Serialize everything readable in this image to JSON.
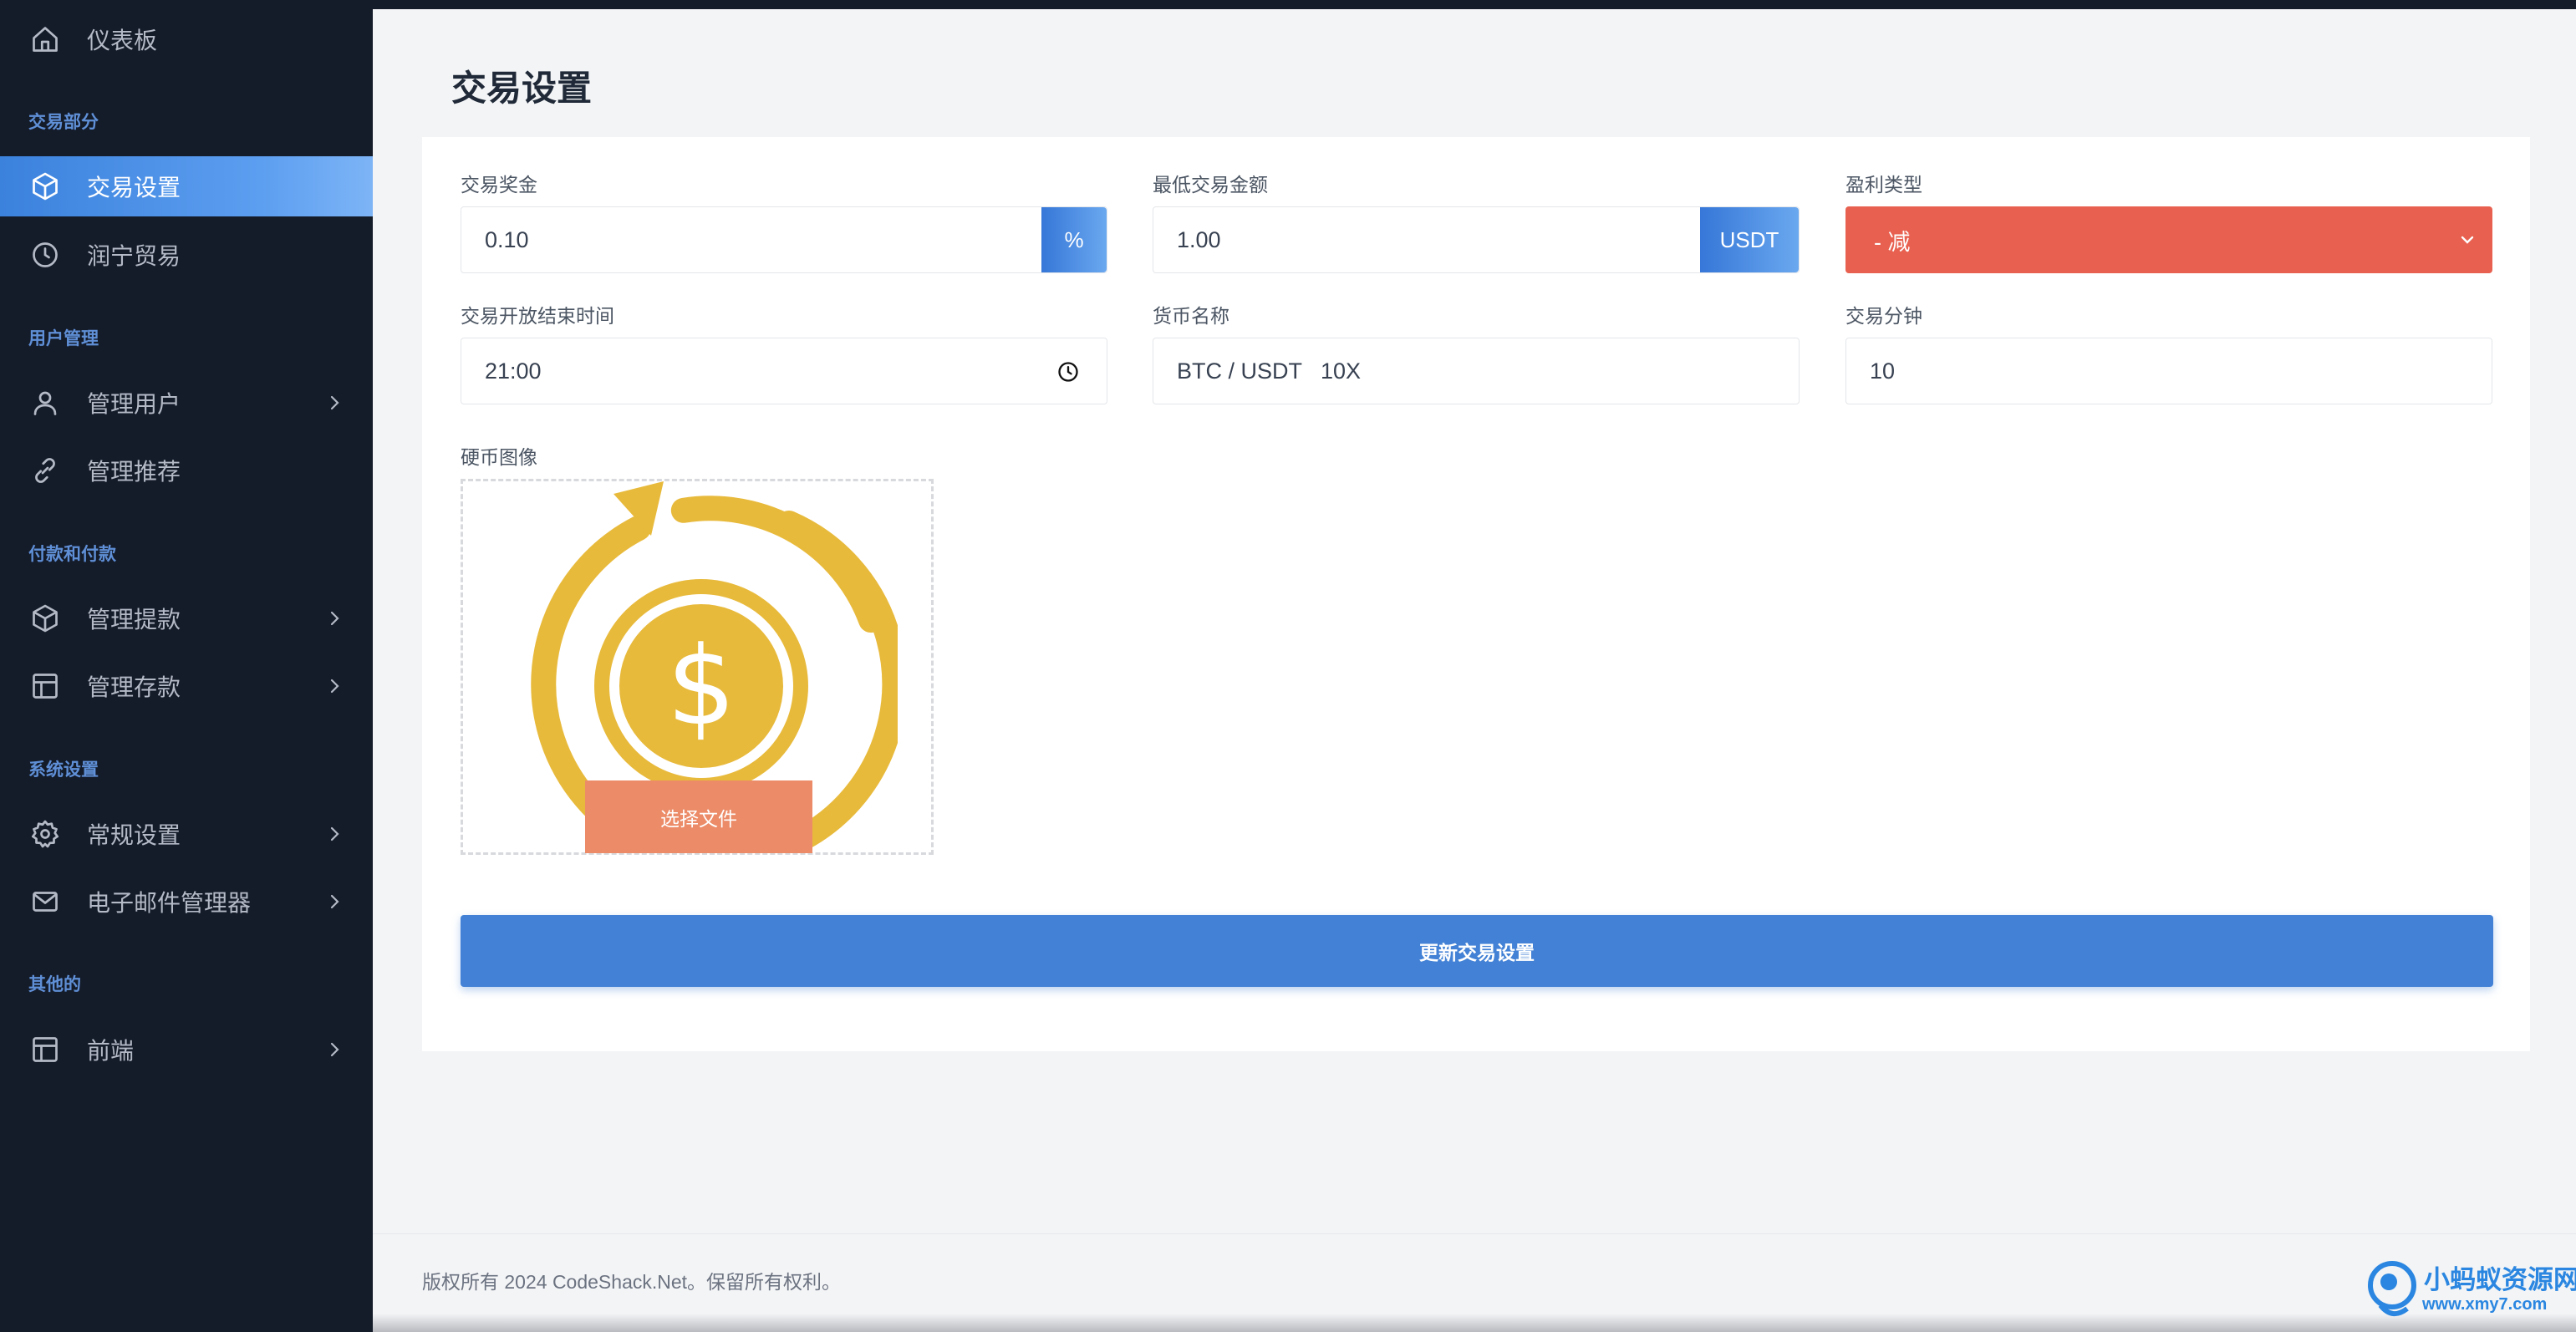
{
  "sidebar": {
    "items": [
      {
        "label": "仪表板",
        "icon": "home-icon"
      },
      {
        "label": "交易设置",
        "icon": "cube-icon",
        "active": true
      },
      {
        "label": "润宁贸易",
        "icon": "clock-icon"
      },
      {
        "label": "管理用户",
        "icon": "user-icon"
      },
      {
        "label": "管理推荐",
        "icon": "link-icon"
      },
      {
        "label": "管理提款",
        "icon": "cube-icon"
      },
      {
        "label": "管理存款",
        "icon": "table-icon"
      },
      {
        "label": "常规设置",
        "icon": "gear-icon"
      },
      {
        "label": "电子邮件管理器",
        "icon": "mail-icon"
      },
      {
        "label": "前端",
        "icon": "layout-icon"
      }
    ],
    "sections": [
      "交易部分",
      "用户管理",
      "付款和付款",
      "系统设置",
      "其他的"
    ]
  },
  "page": {
    "title": "交易设置"
  },
  "form": {
    "bonus": {
      "label": "交易奖金",
      "value": "0.10",
      "addon": "%"
    },
    "min_amount": {
      "label": "最低交易金额",
      "value": "1.00",
      "addon": "USDT"
    },
    "profit_type": {
      "label": "盈利类型",
      "value": "- 减"
    },
    "open_time": {
      "label": "交易开放结束时间",
      "value": "21:00"
    },
    "coin_name": {
      "label": "货币名称",
      "value": "BTC / USDT   10X"
    },
    "trade_minutes": {
      "label": "交易分钟",
      "value": "10"
    },
    "coin_image": {
      "label": "硬币图像",
      "button": "选择文件"
    },
    "submit": "更新交易设置"
  },
  "footer": {
    "copyright": "版权所有 2024 CodeShack.Net。保留所有权利。"
  },
  "watermark": {
    "title": "小蚂蚁资源网",
    "url": "www.xmy7.com"
  },
  "colors": {
    "sidebar_bg": "#141b29",
    "accent": "#3b82dd",
    "profit_select": "#e8604f",
    "upload_button": "#ec8b67",
    "coin": "#e8ba3c"
  }
}
